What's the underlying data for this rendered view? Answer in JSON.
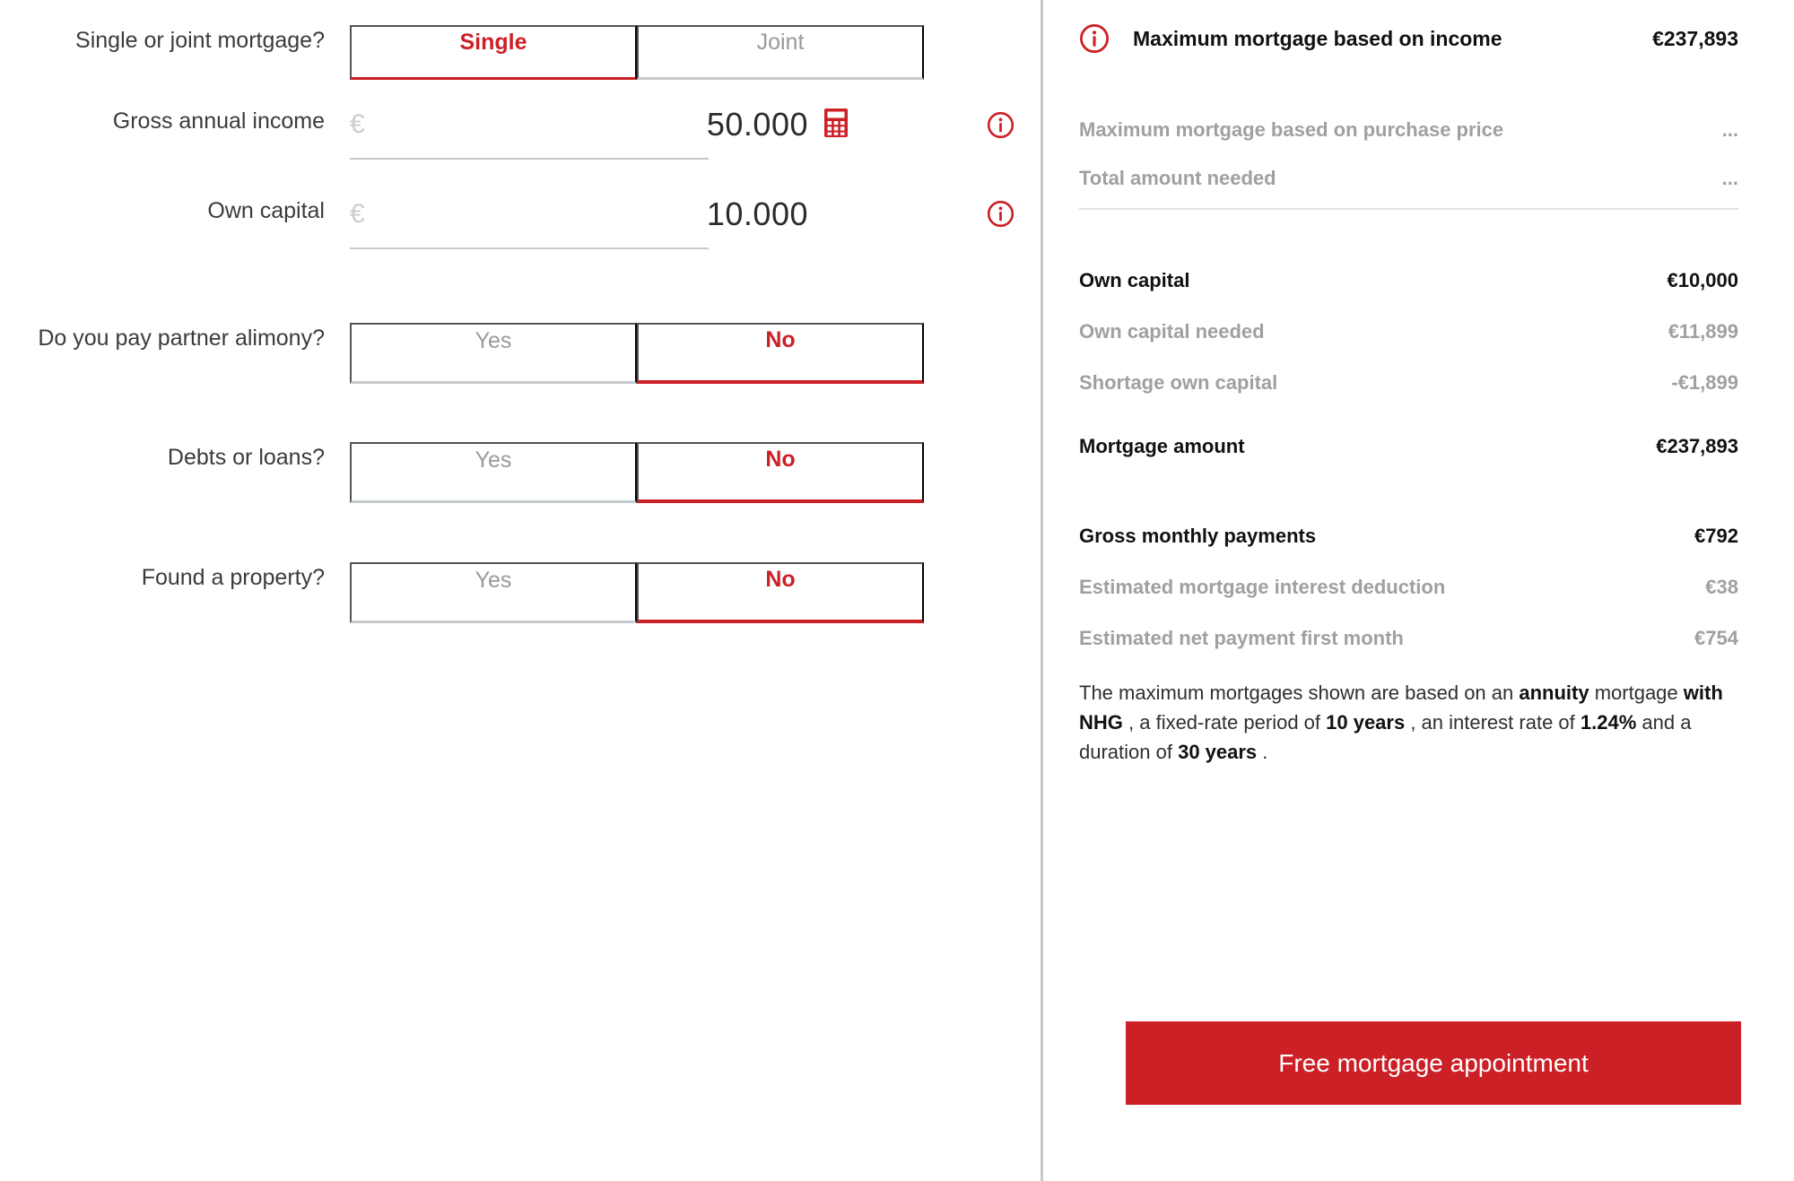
{
  "accent": {
    "red": "#CC2027",
    "gray_line": "#C4C9CD",
    "muted_text": "#A0A0A0",
    "divider": "#C3C9CE"
  },
  "form": {
    "rows": [
      {
        "label": "Single or joint mortgage?",
        "type": "choice",
        "options": [
          "Single",
          "Joint"
        ],
        "selected": "Single"
      },
      {
        "label": "Gross annual income",
        "type": "money",
        "currency": "€",
        "value": "50.000",
        "has_calculator": true,
        "has_info": true
      },
      {
        "label": "Own capital",
        "type": "money",
        "currency": "€",
        "value": "10.000",
        "has_calculator": false,
        "has_info": true
      },
      {
        "label": "Do you pay partner alimony?",
        "type": "choice",
        "options": [
          "Yes",
          "No"
        ],
        "selected": "No"
      },
      {
        "label": "Debts or loans?",
        "type": "choice",
        "options": [
          "Yes",
          "No"
        ],
        "selected": "No"
      },
      {
        "label": "Found a property?",
        "type": "choice",
        "options": [
          "Yes",
          "No"
        ],
        "selected": "No"
      }
    ]
  },
  "summary": {
    "header": {
      "label": "Maximum mortgage based on income",
      "value": "€237,893",
      "icon": "info-icon"
    },
    "header_sub": [
      {
        "label": "Maximum mortgage based on purchase price",
        "value": "..."
      },
      {
        "label": "Total amount needed",
        "value": "..."
      }
    ],
    "capital": [
      {
        "label": "Own capital",
        "value": "€10,000",
        "emphasis": "bold"
      },
      {
        "label": "Own capital needed",
        "value": "€11,899",
        "emphasis": "muted"
      },
      {
        "label": "Shortage own capital",
        "value": "-€1,899",
        "emphasis": "muted"
      }
    ],
    "mortgage": [
      {
        "label": "Mortgage amount",
        "value": "€237,893",
        "emphasis": "bold"
      }
    ],
    "payments": [
      {
        "label": "Gross monthly payments",
        "value": "€792",
        "emphasis": "bold"
      },
      {
        "label": "Estimated mortgage interest deduction",
        "value": "€38",
        "emphasis": "muted"
      },
      {
        "label": "Estimated net payment first month",
        "value": "€754",
        "emphasis": "muted"
      }
    ],
    "disclaimer": {
      "p1": "The maximum mortgages shown are based on an ",
      "b1": "annuity",
      "p2": " mortgage ",
      "b2": "with NHG",
      "p3": " , a fixed-rate period of ",
      "b3": "10 years",
      "p4": " , an interest rate of ",
      "b4": "1.24%",
      "p5": " and a duration of ",
      "b5": "30 years",
      "p6": " ."
    },
    "cta_label": "Free mortgage appointment"
  }
}
